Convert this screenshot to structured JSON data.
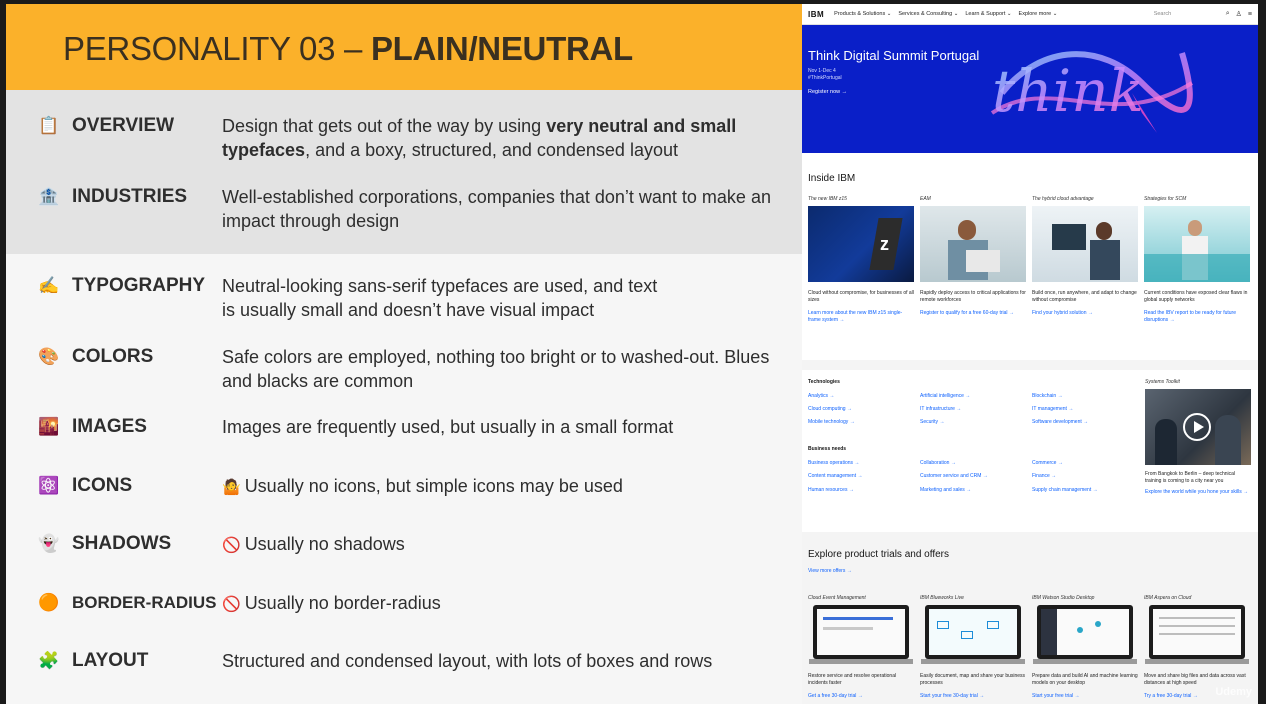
{
  "slide": {
    "title_prefix": "PERSONALITY 03 – ",
    "title_bold": "PLAIN/NEUTRAL",
    "rows": [
      {
        "emoji": "📋",
        "label": "OVERVIEW",
        "desc_1": "Design that gets out of the way by using ",
        "desc_bold": "very neutral and small typefaces",
        "desc_2": ", and a boxy, structured, and condensed layout"
      },
      {
        "emoji": "🏦",
        "label": "INDUSTRIES",
        "desc": "Well-established corporations, companies that don’t want to make an impact through design"
      },
      {
        "emoji": "✍️",
        "label": "TYPOGRAPHY",
        "desc_line1": "Neutral-looking sans-serif typefaces are used, and text",
        "desc_line2": "is usually small and doesn’t have visual impact"
      },
      {
        "emoji": "🎨",
        "label": "COLORS",
        "desc": "Safe colors are employed, nothing too bright or to washed-out. Blues and blacks are common"
      },
      {
        "emoji": "🌇",
        "label": "IMAGES",
        "desc": "Images are frequently used, but usually in a small format"
      },
      {
        "emoji": "⚛️",
        "label": "ICONS",
        "mini": "🤷",
        "desc": "Usually no icons, but simple icons may be used"
      },
      {
        "emoji": "👻",
        "label": "SHADOWS",
        "mini": "🚫",
        "desc": "Usually no shadows"
      },
      {
        "emoji": "🟠",
        "label": "BORDER-RADIUS",
        "mini": "🚫",
        "desc": "Usually no border-radius"
      },
      {
        "emoji": "🧩",
        "label": "LAYOUT",
        "desc": "Structured and condensed layout, with lots of boxes and rows"
      }
    ]
  },
  "ibm": {
    "nav": {
      "logo": "IBM",
      "items": [
        "Products & Solutions ⌄",
        "Services & Consulting ⌄",
        "Learn & Support ⌄",
        "Explore more ⌄"
      ],
      "search_placeholder": "Search",
      "icons": [
        "search-icon",
        "user-icon",
        "menu-icon"
      ]
    },
    "hero": {
      "title": "Think Digital Summit Portugal",
      "sub_line1": "Nov 1-Dec 4",
      "sub_line2": "#ThinkPortugal",
      "link": "Register now →",
      "art_text": "think"
    },
    "inside": {
      "title": "Inside IBM",
      "cards": [
        {
          "head": "The new IBM z15",
          "text": "Cloud without compromise, for businesses of all sizes",
          "link": "Learn more about the new IBM z15 single-frame system →"
        },
        {
          "head": "EAM",
          "text": "Rapidly deploy access to critical applications for remote workforces",
          "link": "Register to qualify for a free 60-day trial →"
        },
        {
          "head": "The hybrid cloud advantage",
          "text": "Build once, run anywhere, and adapt to change without compromise",
          "link": "Find your hybrid solution →"
        },
        {
          "head": "Strategies for SCM",
          "text": "Current conditions have exposed clear flaws in global supply networks",
          "link": "Read the IBV report to be ready for future disruptions →"
        }
      ]
    },
    "tech": {
      "title": "Technologies",
      "col1": [
        "Analytics →",
        "Cloud computing →",
        "Mobile technology →"
      ],
      "col2": [
        "Artificial intelligence →",
        "IT infrastructure →",
        "Security →"
      ],
      "col3": [
        "Blockchain →",
        "IT management →",
        "Software development →"
      ]
    },
    "business": {
      "title": "Business needs",
      "col1": [
        "Business operations →",
        "Content management →",
        "Human resources →"
      ],
      "col2": [
        "Collaboration →",
        "Customer service and CRM →",
        "Marketing and sales →"
      ],
      "col3": [
        "Commerce →",
        "Finance →",
        "Supply chain management →"
      ]
    },
    "toolkit": {
      "head": "Systems Toolkit",
      "text": "From Bangkok to Berlin – deep technical training is coming to a city near you",
      "link": "Explore the world while you hone your skills →"
    },
    "trials": {
      "title": "Explore product trials and offers",
      "view_more": "View more offers →",
      "cards": [
        {
          "head": "Cloud Event Management",
          "text": "Restore service and resolve operational incidents faster",
          "link": "Get a free 30-day trial →"
        },
        {
          "head": "IBM Blueworks Live",
          "text": "Easily document, map and share your business processes",
          "link": "Start your free 30-day trial →"
        },
        {
          "head": "IBM Watson Studio Desktop",
          "text": "Prepare data and build AI and machine learning models on your desktop",
          "link": "Start your free trial →"
        },
        {
          "head": "IBM Aspera on Cloud",
          "text": "Move and share big files and data across vast distances at high speed",
          "link": "Try a free 30-day trial →"
        }
      ]
    }
  },
  "watermark": "Udemy",
  "colors": {
    "title_bar": "#fbb12a",
    "ibm_blue": "#0a1fc8",
    "link_blue": "#0f62fe",
    "band": "#e3e3e3"
  }
}
